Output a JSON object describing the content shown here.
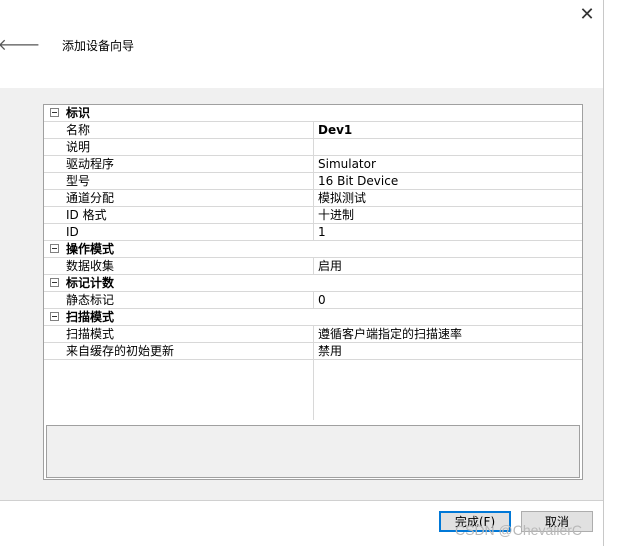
{
  "window": {
    "close_glyph": "✕",
    "back_glyph": "🡐",
    "title": "添加设备向导"
  },
  "grid": {
    "categories": [
      {
        "label": "标识",
        "rows": [
          {
            "name": "名称",
            "value": "Dev1",
            "bold": true
          },
          {
            "name": "说明",
            "value": ""
          },
          {
            "name": "驱动程序",
            "value": "Simulator"
          },
          {
            "name": "型号",
            "value": "16 Bit Device"
          },
          {
            "name": "通道分配",
            "value": "模拟测试"
          },
          {
            "name": "ID 格式",
            "value": "十进制"
          },
          {
            "name": "ID",
            "value": "1"
          }
        ]
      },
      {
        "label": "操作模式",
        "rows": [
          {
            "name": "数据收集",
            "value": "启用"
          }
        ]
      },
      {
        "label": "标记计数",
        "rows": [
          {
            "name": "静态标记",
            "value": "0"
          }
        ]
      },
      {
        "label": "扫描模式",
        "rows": [
          {
            "name": "扫描模式",
            "value": "遵循客户端指定的扫描速率"
          },
          {
            "name": "来自缓存的初始更新",
            "value": "禁用"
          }
        ]
      }
    ]
  },
  "footer": {
    "finish_label": "完成(F)",
    "cancel_label": "取消"
  },
  "watermark": "CSDN @ChevalierC",
  "colors": {
    "accent": "#0078d7",
    "content_bg": "#f0f0f0",
    "button_bg": "#e1e1e1"
  }
}
